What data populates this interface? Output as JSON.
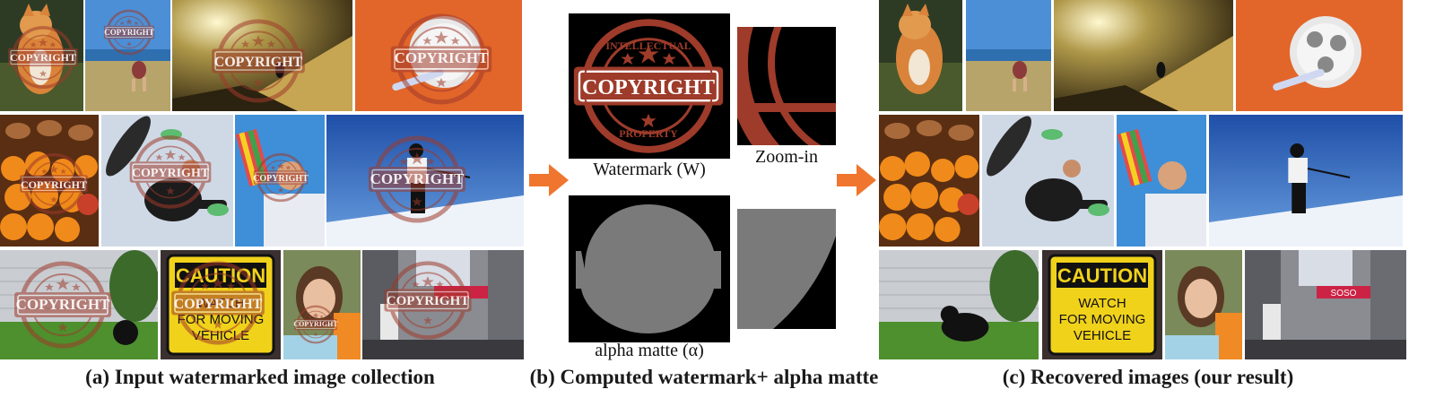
{
  "captions": {
    "a": "(a) Input watermarked image collection",
    "b": "(b) Computed watermark+ alpha matte",
    "c": "(c) Recovered images (our result)"
  },
  "middle": {
    "watermark_label": "Watermark (W)",
    "zoom_label": "Zoom-in",
    "alpha_label": "alpha matte (α)"
  },
  "stamp": {
    "top": "INTELLECTUAL",
    "center": "COPYRIGHT",
    "bottom": "PROPERTY",
    "color": "#9e3b2a"
  },
  "signs": {
    "caution": "CAUTION",
    "watch": "WATCH",
    "moving": "FOR MOVING",
    "vehicle": "VEHICLE",
    "soso": "SOSO"
  },
  "colors": {
    "arrow": "#f0752e",
    "matte": "#7a7a7a"
  }
}
